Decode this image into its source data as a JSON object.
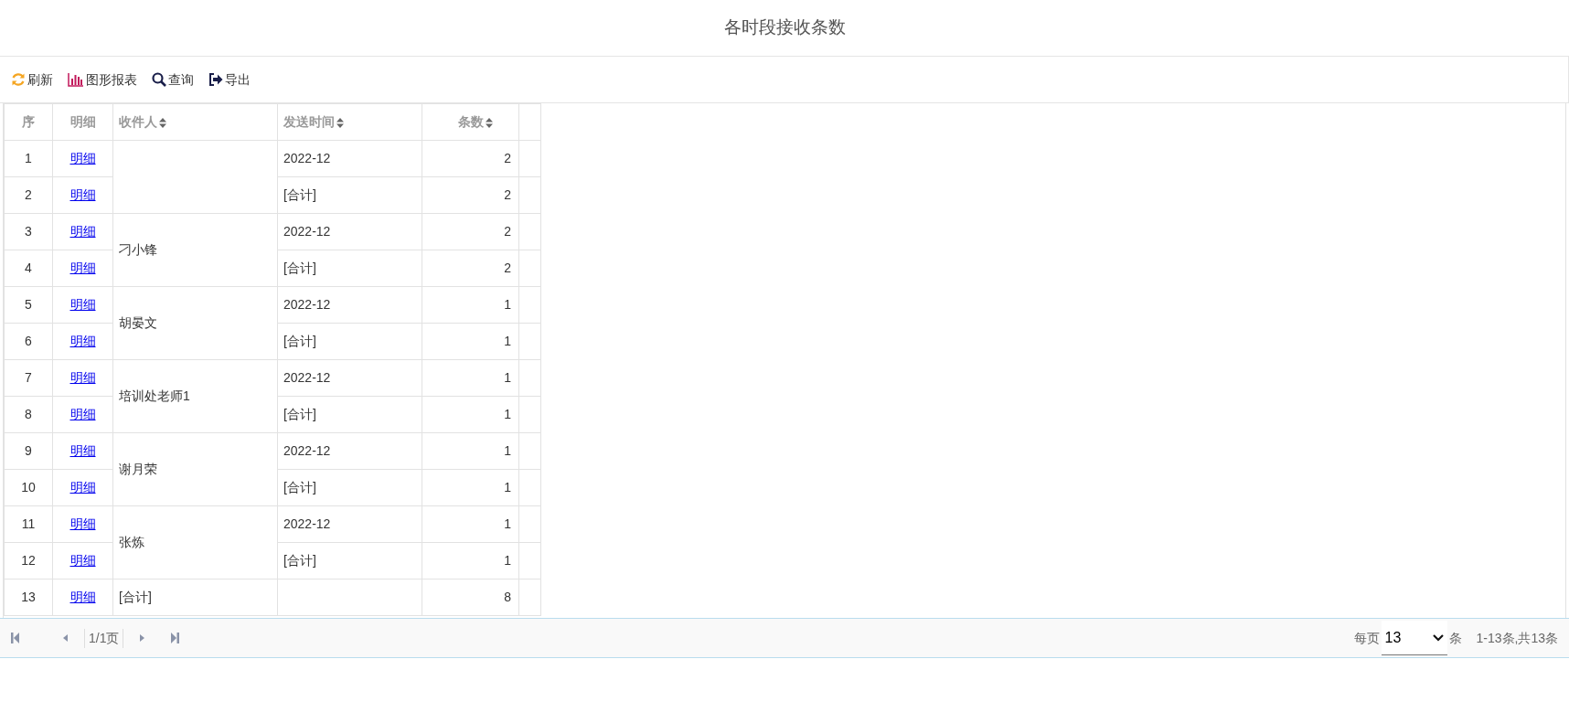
{
  "title": "各时段接收条数",
  "toolbar": [
    {
      "kind": "refresh",
      "label": "刷新"
    },
    {
      "kind": "chart",
      "label": "图形报表"
    },
    {
      "kind": "search",
      "label": "查询"
    },
    {
      "kind": "export",
      "label": "导出"
    }
  ],
  "columns": [
    {
      "label": "序",
      "sortable": false
    },
    {
      "label": "明细",
      "sortable": false
    },
    {
      "label": "收件人",
      "sortable": true
    },
    {
      "label": "发送时间",
      "sortable": true
    },
    {
      "label": "条数",
      "sortable": true
    }
  ],
  "groups": [
    {
      "rows": [
        {
          "seq": "1",
          "detail": "明细",
          "time": "2022-12",
          "count": "2"
        },
        {
          "seq": "2",
          "detail": "明细",
          "time": "[合计]",
          "count": "2"
        }
      ]
    },
    {
      "recipient": "刁小锋",
      "rows": [
        {
          "seq": "3",
          "detail": "明细",
          "time": "2022-12",
          "count": "2"
        },
        {
          "seq": "4",
          "detail": "明细",
          "time": "[合计]",
          "count": "2"
        }
      ]
    },
    {
      "recipient": "胡晏文",
      "rows": [
        {
          "seq": "5",
          "detail": "明细",
          "time": "2022-12",
          "count": "1"
        },
        {
          "seq": "6",
          "detail": "明细",
          "time": "[合计]",
          "count": "1"
        }
      ]
    },
    {
      "recipient": "培训处老师1",
      "rows": [
        {
          "seq": "7",
          "detail": "明细",
          "time": "2022-12",
          "count": "1"
        },
        {
          "seq": "8",
          "detail": "明细",
          "time": "[合计]",
          "count": "1"
        }
      ]
    },
    {
      "recipient": "谢月荣",
      "rows": [
        {
          "seq": "9",
          "detail": "明细",
          "time": "2022-12",
          "count": "1"
        },
        {
          "seq": "10",
          "detail": "明细",
          "time": "[合计]",
          "count": "1"
        }
      ]
    },
    {
      "recipient": "张炼",
      "rows": [
        {
          "seq": "11",
          "detail": "明细",
          "time": "2022-12",
          "count": "1"
        },
        {
          "seq": "12",
          "detail": "明细",
          "time": "[合计]",
          "count": "1"
        }
      ]
    },
    {
      "recipient": "[合计]",
      "rows": [
        {
          "seq": "13",
          "detail": "明细",
          "count": "8"
        }
      ]
    }
  ],
  "pager": {
    "page": "1/1页",
    "per_page_label": "每页",
    "per_page": "13",
    "unit": "条",
    "summary": "1-13条,共13条"
  }
}
